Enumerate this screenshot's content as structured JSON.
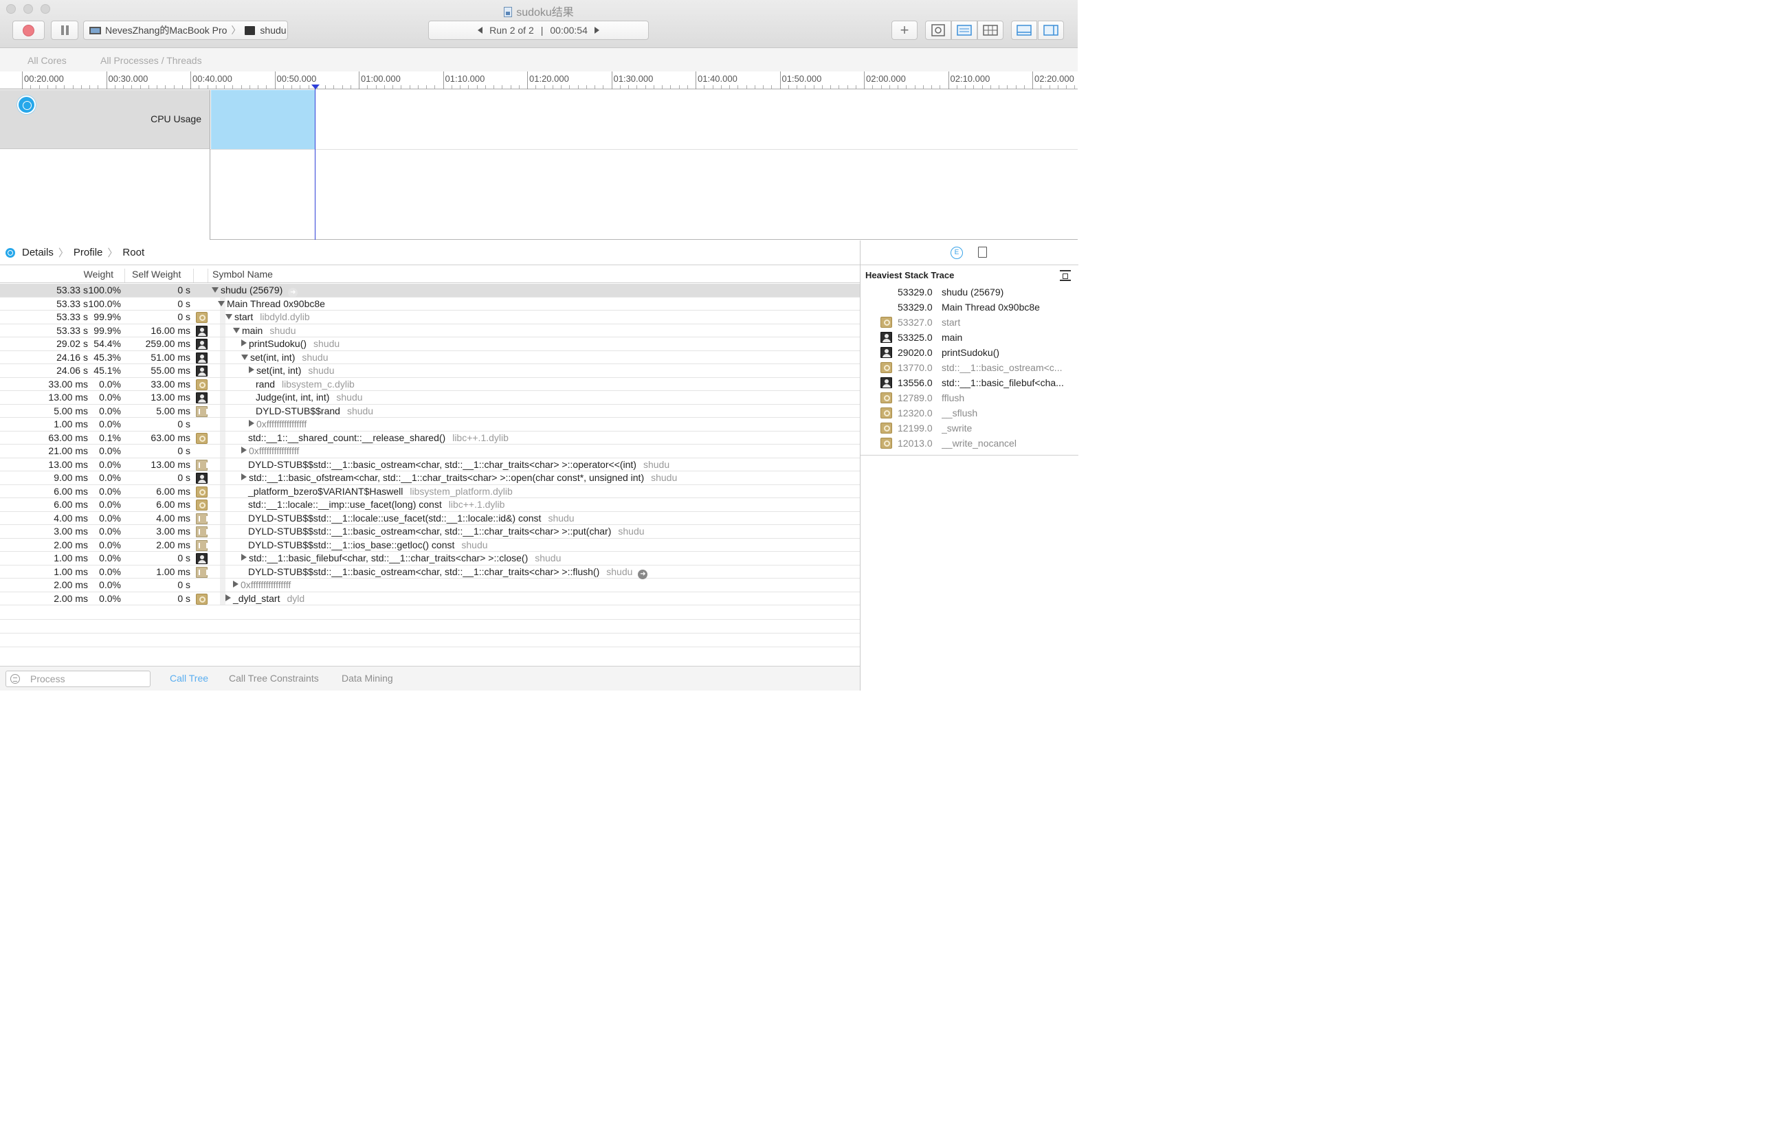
{
  "window": {
    "title": "sudoku结果"
  },
  "toolbar": {
    "device": "NevesZhang的MacBook Pro",
    "process": "shudu",
    "run_label": "Run 2 of 2",
    "run_sep": "|",
    "run_time": "00:00:54"
  },
  "scope": {
    "all_cores": "All Cores",
    "all_processes": "All Processes / Threads"
  },
  "ruler": {
    "ticks": [
      "00:20.000",
      "00:30.000",
      "00:40.000",
      "00:50.000",
      "01:00.000",
      "01:10.000",
      "01:20.000",
      "01:30.000",
      "01:40.000",
      "01:50.000",
      "02:00.000",
      "02:10.000",
      "02:20.000"
    ]
  },
  "track": {
    "label": "CPU Usage"
  },
  "breadcrumb": {
    "details": "Details",
    "profile": "Profile",
    "root": "Root"
  },
  "columns": {
    "weight": "Weight",
    "self_weight": "Self Weight",
    "symbol": "Symbol Name"
  },
  "rows": [
    {
      "weight": "53.33 s",
      "pct": "100.0%",
      "self": "0 s",
      "icon": "",
      "depth": 0,
      "disc": "open",
      "symbol": "shudu (25679)",
      "lib": "",
      "focus": "faint"
    },
    {
      "weight": "53.33 s",
      "pct": "100.0%",
      "self": "0 s",
      "icon": "",
      "depth": 1,
      "disc": "open",
      "symbol": "Main Thread  0x90bc8e",
      "lib": "",
      "focus": ""
    },
    {
      "weight": "53.33 s",
      "pct": "99.9%",
      "self": "0 s",
      "icon": "gear",
      "depth": 2,
      "disc": "open",
      "symbol": "start",
      "lib": "libdyld.dylib",
      "focus": ""
    },
    {
      "weight": "53.33 s",
      "pct": "99.9%",
      "self": "16.00 ms",
      "icon": "user",
      "depth": 3,
      "disc": "open",
      "symbol": "main",
      "lib": "shudu",
      "focus": ""
    },
    {
      "weight": "29.02 s",
      "pct": "54.4%",
      "self": "259.00 ms",
      "icon": "user",
      "depth": 4,
      "disc": "closed",
      "symbol": "printSudoku()",
      "lib": "shudu",
      "focus": ""
    },
    {
      "weight": "24.16 s",
      "pct": "45.3%",
      "self": "51.00 ms",
      "icon": "user",
      "depth": 4,
      "disc": "open",
      "symbol": "set(int, int)",
      "lib": "shudu",
      "focus": ""
    },
    {
      "weight": "24.06 s",
      "pct": "45.1%",
      "self": "55.00 ms",
      "icon": "user",
      "depth": 5,
      "disc": "closed",
      "symbol": "set(int, int)",
      "lib": "shudu",
      "focus": ""
    },
    {
      "weight": "33.00 ms",
      "pct": "0.0%",
      "self": "33.00 ms",
      "icon": "gear",
      "depth": 5,
      "disc": "",
      "symbol": "rand",
      "lib": "libsystem_c.dylib",
      "focus": ""
    },
    {
      "weight": "13.00 ms",
      "pct": "0.0%",
      "self": "13.00 ms",
      "icon": "user",
      "depth": 5,
      "disc": "",
      "symbol": "Judge(int, int, int)",
      "lib": "shudu",
      "focus": ""
    },
    {
      "weight": "5.00 ms",
      "pct": "0.0%",
      "self": "5.00 ms",
      "icon": "lib",
      "depth": 5,
      "disc": "",
      "symbol": "DYLD-STUB$$rand",
      "lib": "shudu",
      "focus": ""
    },
    {
      "weight": "1.00 ms",
      "pct": "0.0%",
      "self": "0 s",
      "icon": "",
      "depth": 5,
      "disc": "closed",
      "symbol": "0xffffffffffffffff",
      "lib": "",
      "focus": "",
      "dim": true
    },
    {
      "weight": "63.00 ms",
      "pct": "0.1%",
      "self": "63.00 ms",
      "icon": "gear",
      "depth": 4,
      "disc": "",
      "symbol": "std::__1::__shared_count::__release_shared()",
      "lib": "libc++.1.dylib",
      "focus": ""
    },
    {
      "weight": "21.00 ms",
      "pct": "0.0%",
      "self": "0 s",
      "icon": "",
      "depth": 4,
      "disc": "closed",
      "symbol": "0xffffffffffffffff",
      "lib": "",
      "focus": "",
      "dim": true
    },
    {
      "weight": "13.00 ms",
      "pct": "0.0%",
      "self": "13.00 ms",
      "icon": "lib",
      "depth": 4,
      "disc": "",
      "symbol": "DYLD-STUB$$std::__1::basic_ostream<char, std::__1::char_traits<char> >::operator<<(int)",
      "lib": "shudu",
      "focus": ""
    },
    {
      "weight": "9.00 ms",
      "pct": "0.0%",
      "self": "0 s",
      "icon": "user",
      "depth": 4,
      "disc": "closed",
      "symbol": "std::__1::basic_ofstream<char, std::__1::char_traits<char> >::open(char const*, unsigned int)",
      "lib": "shudu",
      "focus": ""
    },
    {
      "weight": "6.00 ms",
      "pct": "0.0%",
      "self": "6.00 ms",
      "icon": "gear",
      "depth": 4,
      "disc": "",
      "symbol": "_platform_bzero$VARIANT$Haswell",
      "lib": "libsystem_platform.dylib",
      "focus": ""
    },
    {
      "weight": "6.00 ms",
      "pct": "0.0%",
      "self": "6.00 ms",
      "icon": "gear",
      "depth": 4,
      "disc": "",
      "symbol": "std::__1::locale::__imp::use_facet(long) const",
      "lib": "libc++.1.dylib",
      "focus": ""
    },
    {
      "weight": "4.00 ms",
      "pct": "0.0%",
      "self": "4.00 ms",
      "icon": "lib",
      "depth": 4,
      "disc": "",
      "symbol": "DYLD-STUB$$std::__1::locale::use_facet(std::__1::locale::id&) const",
      "lib": "shudu",
      "focus": ""
    },
    {
      "weight": "3.00 ms",
      "pct": "0.0%",
      "self": "3.00 ms",
      "icon": "lib",
      "depth": 4,
      "disc": "",
      "symbol": "DYLD-STUB$$std::__1::basic_ostream<char, std::__1::char_traits<char> >::put(char)",
      "lib": "shudu",
      "focus": ""
    },
    {
      "weight": "2.00 ms",
      "pct": "0.0%",
      "self": "2.00 ms",
      "icon": "lib",
      "depth": 4,
      "disc": "",
      "symbol": "DYLD-STUB$$std::__1::ios_base::getloc() const",
      "lib": "shudu",
      "focus": ""
    },
    {
      "weight": "1.00 ms",
      "pct": "0.0%",
      "self": "0 s",
      "icon": "user",
      "depth": 4,
      "disc": "closed",
      "symbol": "std::__1::basic_filebuf<char, std::__1::char_traits<char> >::close()",
      "lib": "shudu",
      "focus": ""
    },
    {
      "weight": "1.00 ms",
      "pct": "0.0%",
      "self": "1.00 ms",
      "icon": "lib",
      "depth": 4,
      "disc": "",
      "symbol": "DYLD-STUB$$std::__1::basic_ostream<char, std::__1::char_traits<char> >::flush()",
      "lib": "shudu",
      "focus": "dark"
    },
    {
      "weight": "2.00 ms",
      "pct": "0.0%",
      "self": "0 s",
      "icon": "",
      "depth": 3,
      "disc": "closed",
      "symbol": "0xffffffffffffffff",
      "lib": "",
      "focus": "",
      "dim": true
    },
    {
      "weight": "2.00 ms",
      "pct": "0.0%",
      "self": "0 s",
      "icon": "gear",
      "depth": 2,
      "disc": "closed",
      "symbol": "_dyld_start",
      "lib": "dyld",
      "focus": ""
    }
  ],
  "bottom": {
    "search_placeholder": "Process",
    "tabs": [
      "Call Tree",
      "Call Tree Constraints",
      "Data Mining"
    ]
  },
  "sidebar": {
    "title": "Heaviest Stack Trace",
    "items": [
      {
        "value": "53329.0",
        "name": "shudu (25679)",
        "icon": "",
        "dim": false
      },
      {
        "value": "53329.0",
        "name": "Main Thread  0x90bc8e",
        "icon": "",
        "dim": false
      },
      {
        "value": "53327.0",
        "name": "start",
        "icon": "gear",
        "dim": true
      },
      {
        "value": "53325.0",
        "name": "main",
        "icon": "user",
        "dim": false
      },
      {
        "value": "29020.0",
        "name": "printSudoku()",
        "icon": "user",
        "dim": false
      },
      {
        "value": "13770.0",
        "name": "std::__1::basic_ostream<c...",
        "icon": "gear",
        "dim": true
      },
      {
        "value": "13556.0",
        "name": "std::__1::basic_filebuf<cha...",
        "icon": "user",
        "dim": false
      },
      {
        "value": "12789.0",
        "name": "fflush",
        "icon": "gear",
        "dim": true
      },
      {
        "value": "12320.0",
        "name": "__sflush",
        "icon": "gear",
        "dim": true
      },
      {
        "value": "12199.0",
        "name": "_swrite",
        "icon": "gear",
        "dim": true
      },
      {
        "value": "12013.0",
        "name": "__write_nocancel",
        "icon": "gear",
        "dim": true
      }
    ]
  },
  "colors": {
    "accent": "#26a7ea",
    "cpu_fill": "#a9dcf8",
    "playhead": "#2f3fd8",
    "record": "#ee7c84"
  }
}
